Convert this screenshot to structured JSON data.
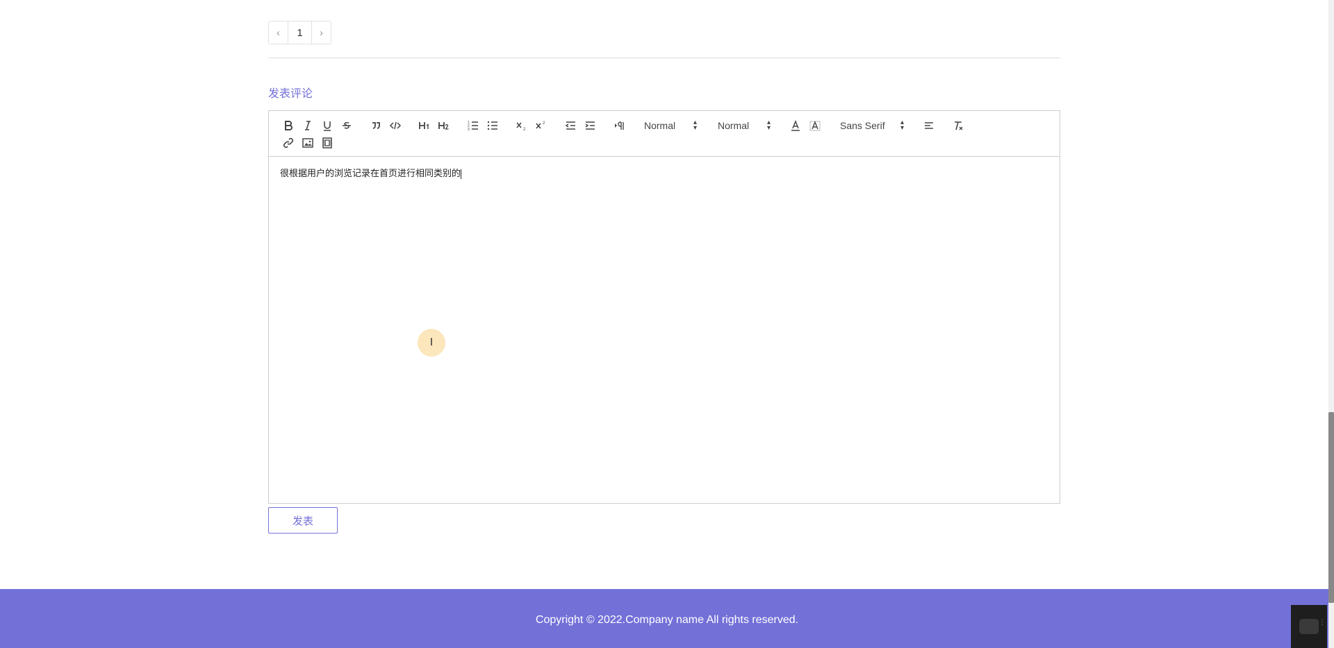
{
  "pagination": {
    "prev": "‹",
    "page": "1",
    "next": "›"
  },
  "comment": {
    "title": "发表评论",
    "content": "很根据用户的浏览记录在首页进行相同类别的",
    "submit_label": "发表"
  },
  "toolbar": {
    "header_picker": "Normal",
    "size_picker": "Normal",
    "font_picker": "Sans Serif",
    "buttons_row1": [
      "bold-icon",
      "italic-icon",
      "underline-icon",
      "strike-icon",
      "blockquote-icon",
      "code-block-icon",
      "header-1-icon",
      "header-2-icon",
      "ordered-list-icon",
      "bullet-list-icon",
      "subscript-icon",
      "superscript-icon",
      "outdent-icon",
      "indent-icon",
      "direction-icon",
      "color-icon",
      "background-icon",
      "align-icon",
      "clean-icon"
    ],
    "buttons_row2": [
      "link-icon",
      "image-icon",
      "video-icon"
    ]
  },
  "footer": {
    "text": "Copyright © 2022.Company name All rights reserved."
  },
  "colors": {
    "accent": "#7370d8",
    "footer_bg": "#7370d8",
    "border": "#cccccc"
  }
}
